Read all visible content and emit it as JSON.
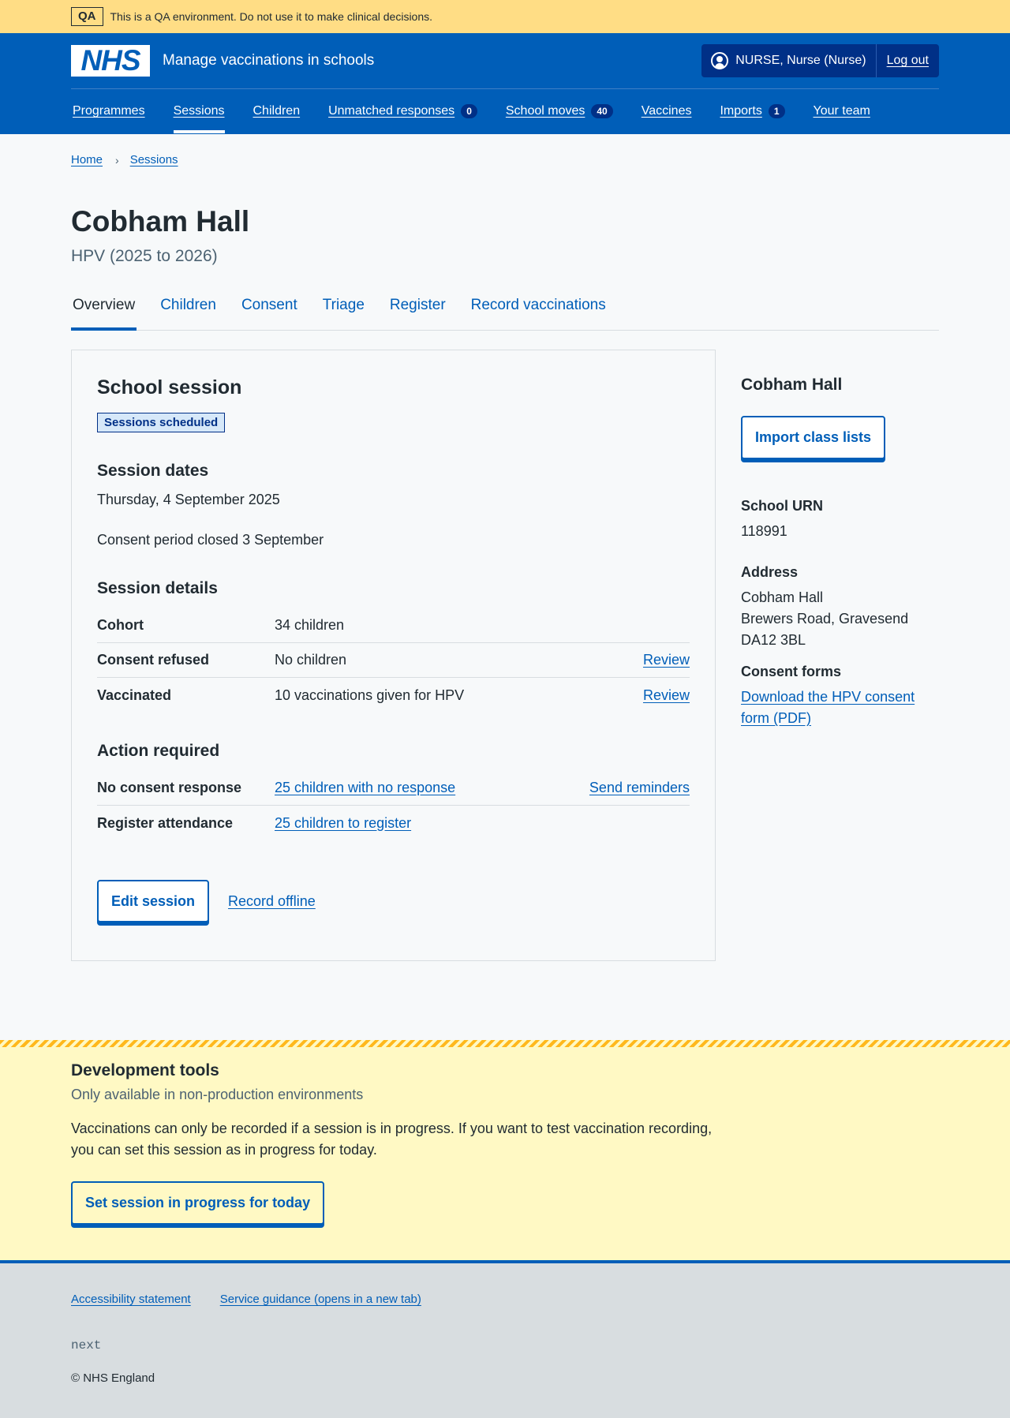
{
  "qa_banner": {
    "tag": "QA",
    "text": "This is a QA environment. Do not use it to make clinical decisions."
  },
  "header": {
    "logo_text": "NHS",
    "service_name": "Manage vaccinations in schools",
    "user": "NURSE, Nurse (Nurse)",
    "logout": "Log out"
  },
  "nav": [
    {
      "label": "Programmes"
    },
    {
      "label": "Sessions",
      "active": true
    },
    {
      "label": "Children"
    },
    {
      "label": "Unmatched responses",
      "count": "0"
    },
    {
      "label": "School moves",
      "count": "40"
    },
    {
      "label": "Vaccines"
    },
    {
      "label": "Imports",
      "count": "1"
    },
    {
      "label": "Your team"
    }
  ],
  "breadcrumb": {
    "home": "Home",
    "sessions": "Sessions",
    "separator": "›"
  },
  "page": {
    "title": "Cobham Hall",
    "caption": "HPV (2025 to 2026)"
  },
  "tabs": [
    "Overview",
    "Children",
    "Consent",
    "Triage",
    "Register",
    "Record vaccinations"
  ],
  "card": {
    "title": "School session",
    "status": "Sessions scheduled",
    "dates_heading": "Session dates",
    "date": "Thursday, 4 September 2025",
    "consent_period": "Consent period closed 3 September",
    "details_heading": "Session details",
    "details": [
      {
        "key": "Cohort",
        "value": "34 children",
        "action": ""
      },
      {
        "key": "Consent refused",
        "value": "No children",
        "action": "Review"
      },
      {
        "key": "Vaccinated",
        "value": "10 vaccinations given for HPV",
        "action": "Review"
      }
    ],
    "action_heading": "Action required",
    "actions": [
      {
        "key": "No consent response",
        "value": "25 children with no response",
        "action": "Send reminders"
      },
      {
        "key": "Register attendance",
        "value": "25 children to register",
        "action": ""
      }
    ],
    "edit_button": "Edit session",
    "offline_link": "Record offline"
  },
  "aside": {
    "title": "Cobham Hall",
    "import_button": "Import class lists",
    "urn_label": "School URN",
    "urn": "118991",
    "address_label": "Address",
    "address_line1": "Cobham Hall",
    "address_line2": "Brewers Road, Gravesend",
    "address_line3": "DA12 3BL",
    "consent_label": "Consent forms",
    "consent_link": "Download the HPV consent form (PDF)"
  },
  "devtools": {
    "title": "Development tools",
    "subtitle": "Only available in non-production environments",
    "description": "Vaccinations can only be recorded if a session is in progress. If you want to test vaccination recording, you can set this session as in progress for today.",
    "button": "Set session in progress for today"
  },
  "footer": {
    "links": [
      "Accessibility statement",
      "Service guidance (opens in a new tab)"
    ],
    "version": "next",
    "copyright": "© NHS England"
  },
  "colors": {
    "brand": "#005eb8",
    "qa_banner": "#ffdd85",
    "devtools_bg": "#fff9c4",
    "text": "#212b32"
  }
}
